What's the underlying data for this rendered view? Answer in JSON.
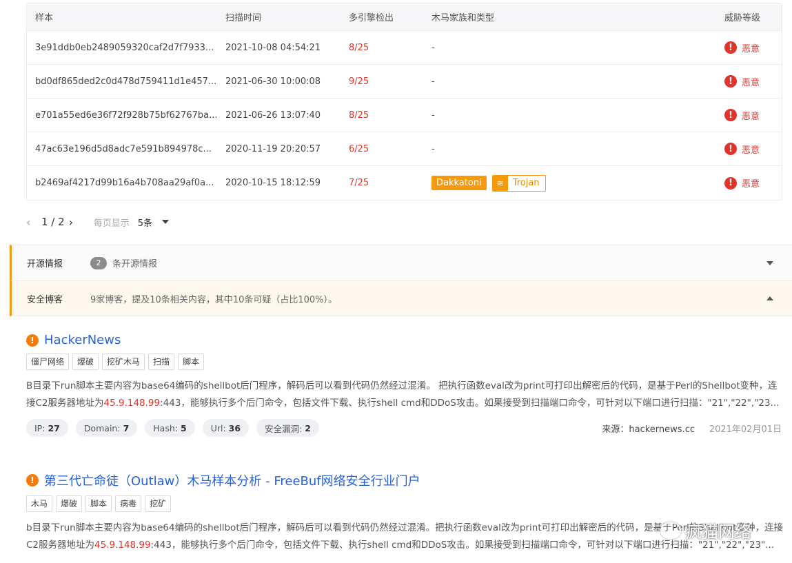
{
  "table": {
    "headers": [
      "样本",
      "扫描时间",
      "多引擎检出",
      "木马家族和类型",
      "威胁等级"
    ],
    "rows": [
      {
        "sample": "3e91ddb0eb2489059320caf2d7f7933...",
        "time": "2021-10-08 04:54:21",
        "detect": "8/25",
        "family": "-",
        "level": "恶意"
      },
      {
        "sample": "bd0df865ded2c0d478d759411d1e457...",
        "time": "2021-06-30 10:00:08",
        "detect": "9/25",
        "family": "-",
        "level": "恶意"
      },
      {
        "sample": "e701a55ed6e36f72f928b75bf62767ba...",
        "time": "2021-06-26 13:07:40",
        "detect": "8/25",
        "family": "-",
        "level": "恶意"
      },
      {
        "sample": "47ac63e196d5d8adc7e591b894978c...",
        "time": "2020-11-19 20:20:57",
        "detect": "6/25",
        "family": "-",
        "level": "恶意"
      },
      {
        "sample": "b2469af4217d99b16a4b708aa29af0a...",
        "time": "2020-10-15 18:12:59",
        "detect": "7/25",
        "family_tag": "Dakkatoni",
        "type_tag": "Trojan",
        "level": "恶意"
      }
    ]
  },
  "pager": {
    "page": "1 / 2",
    "per_label": "每页显示",
    "per_value": "5条"
  },
  "sections": {
    "open_source": {
      "title": "开源情报",
      "count": "2",
      "desc": "条开源情报"
    },
    "blog": {
      "title": "安全博客",
      "desc": "9家博客，提及10条相关内容，其中10条可疑（占比100%）。"
    }
  },
  "articles": [
    {
      "title": "HackerNews",
      "tags": [
        "僵尸网络",
        "爆破",
        "挖矿木马",
        "扫描",
        "脚本"
      ],
      "text_a": "B目录下run脚本主要内容为base64编码的shellbot后门程序，解码后可以看到代码仍然经过混淆。 把执行函数eval改为print可打印出解密后的代码，是基于Perl的Shellbot变种，连接C2服务器地址为",
      "ip": "45.9.148.99",
      "text_b": ":443，能够执行多个后门命令，包括文件下载、执行shell cmd和DDoS攻击。如果接受到扫描端口命令，可针对以下端口进行扫描：\"21\",\"22\",\"23...",
      "pills": [
        {
          "label": "IP:",
          "value": "27"
        },
        {
          "label": "Domain:",
          "value": "7"
        },
        {
          "label": "Hash:",
          "value": "5"
        },
        {
          "label": "Url:",
          "value": "36"
        },
        {
          "label": "安全漏洞:",
          "value": "2"
        }
      ],
      "source": "来源：hackernews.cc",
      "date": "2021年02月01日"
    },
    {
      "title": "第三代亡命徒（Outlaw）木马样本分析 - FreeBuf网络安全行业门户",
      "tags": [
        "木马",
        "爆破",
        "脚本",
        "病毒",
        "挖矿"
      ],
      "text_a": "b目录下run脚本主要内容为base64编码的shellbot后门程序，解码后可以看到代码仍然经过混淆。把执行函数eval改为print可打印出解密后的代码，是基于Perl的Shellbot变种，连接C2服务器地址为",
      "ip": "45.9.148.99",
      "text_b": ":443，能够执行多个后门命令，包括文件下载、执行shell cmd和DDoS攻击。如果接受到扫描端口命令，可针对以下端口进行扫描：\"21\",\"22\",\"23\"..."
    }
  ],
  "watermark": "疯猫网络"
}
